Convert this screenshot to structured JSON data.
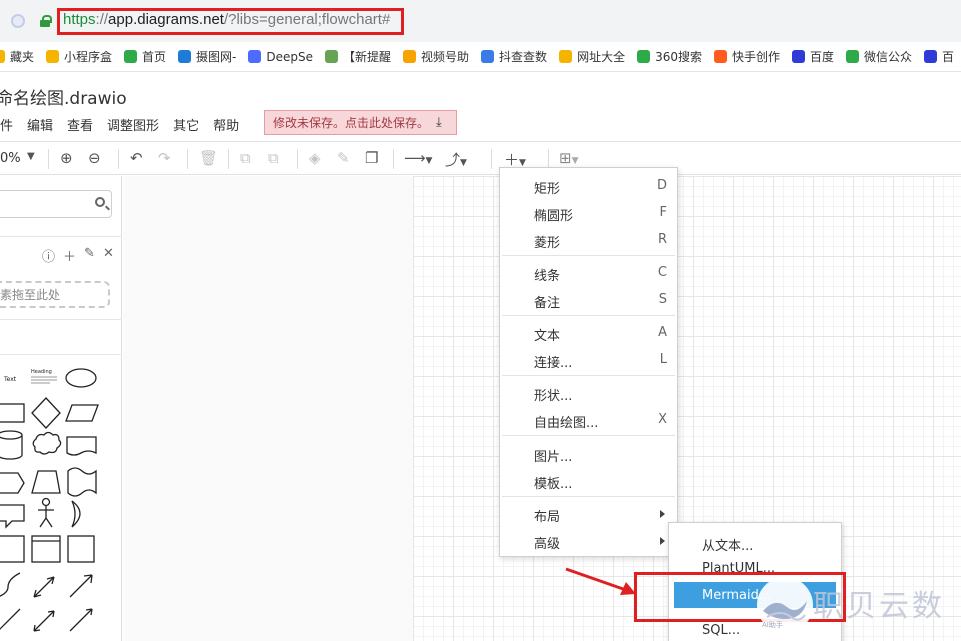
{
  "browser": {
    "url_scheme": "https",
    "url_sep": "://",
    "url_host": "app.diagrams.net",
    "url_rest": "/?libs=general;flowchart#"
  },
  "bookmarks": [
    {
      "label": "藏夹",
      "color": "#f4b400"
    },
    {
      "label": "小程序盒",
      "color": "#f4b400"
    },
    {
      "label": "首页",
      "color": "#2eaa48"
    },
    {
      "label": "摄图网-",
      "color": "#1f7bd8"
    },
    {
      "label": "DeepSe",
      "color": "#4d6bfe"
    },
    {
      "label": "【新提醒",
      "color": "#66a354"
    },
    {
      "label": "视频号助",
      "color": "#f7a300"
    },
    {
      "label": "抖查查数",
      "color": "#3b7be6"
    },
    {
      "label": "网址大全",
      "color": "#f4b400"
    },
    {
      "label": "360搜索",
      "color": "#2eaa48"
    },
    {
      "label": "快手创作",
      "color": "#ff5b1f"
    },
    {
      "label": "百度",
      "color": "#2f3bd6"
    },
    {
      "label": "微信公众",
      "color": "#2eaa48"
    },
    {
      "label": "百",
      "color": "#2f3bd6"
    }
  ],
  "app": {
    "title": "命名绘图.drawio",
    "menu": [
      "件",
      "编辑",
      "查看",
      "调整图形",
      "其它",
      "帮助"
    ],
    "save_warning": "修改未保存。点击此处保存。"
  },
  "toolbar": {
    "zoom": "0%"
  },
  "sidebar": {
    "search_placeholder": "",
    "drop_zone": "素拖至此处",
    "shape_labels": {
      "text": "Text",
      "heading": "Heading"
    }
  },
  "insert_menu": {
    "items": [
      {
        "label": "矩形",
        "key": "D"
      },
      {
        "label": "椭圆形",
        "key": "F"
      },
      {
        "label": "菱形",
        "key": "R"
      },
      {
        "label": "线条",
        "key": "C"
      },
      {
        "label": "备注",
        "key": "S"
      },
      {
        "label": "文本",
        "key": "A"
      },
      {
        "label": "连接...",
        "key": "L"
      },
      {
        "label": "形状...",
        "key": ""
      },
      {
        "label": "自由绘图...",
        "key": "X"
      },
      {
        "label": "图片...",
        "key": ""
      },
      {
        "label": "模板...",
        "key": ""
      },
      {
        "label": "布局",
        "key": ""
      },
      {
        "label": "高级",
        "key": ""
      }
    ]
  },
  "advanced_submenu": {
    "items": [
      "从文本...",
      "PlantUML...",
      "Mermaid...",
      "SQL..."
    ],
    "selected": "Mermaid..."
  },
  "watermark": {
    "text": "职贝云数",
    "sub": "AI助手"
  }
}
